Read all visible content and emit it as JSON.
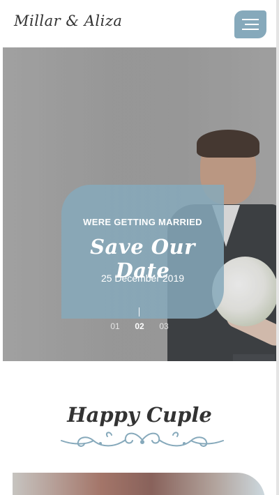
{
  "header": {
    "logo": "Millar & Aliza",
    "menu_icon": "hamburger-menu-icon"
  },
  "hero": {
    "kicker": "WERE GETTING MARRIED",
    "title": "Save Our Date",
    "date": "25 December 2019",
    "slides": [
      "01",
      "02",
      "03"
    ],
    "active_slide": "02"
  },
  "couple_section": {
    "title": "Happy Cuple",
    "ornament": "floral-divider-ornament"
  },
  "colors": {
    "accent": "#86a9bb",
    "text": "#333333"
  }
}
